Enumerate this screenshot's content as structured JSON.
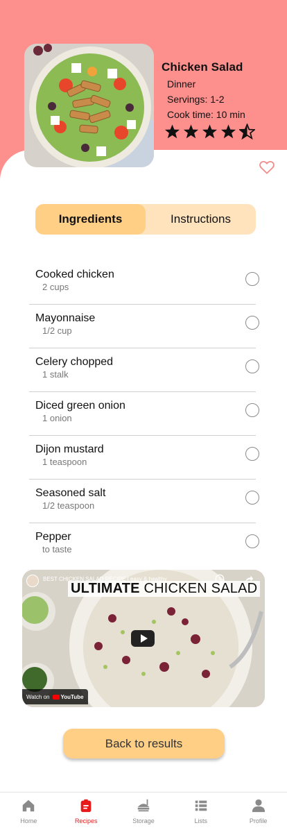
{
  "recipe": {
    "title": "Chicken Salad",
    "meal_type": "Dinner",
    "servings": "Servings: 1-2",
    "cook_time": "Cook time: 10 min",
    "rating": 4.5,
    "rating_max": 5
  },
  "tabs": [
    {
      "label": "Ingredients",
      "active": true
    },
    {
      "label": "Instructions",
      "active": false
    }
  ],
  "ingredients": [
    {
      "name": "Cooked chicken",
      "qty": "2 cups",
      "checked": false
    },
    {
      "name": "Mayonnaise",
      "qty": "1/2 cup",
      "checked": false
    },
    {
      "name": "Celery chopped",
      "qty": "1 stalk",
      "checked": false
    },
    {
      "name": "Diced green onion",
      "qty": "1 onion",
      "checked": false
    },
    {
      "name": "Dijon mustard",
      "qty": "1 teaspoon",
      "checked": false
    },
    {
      "name": "Seasoned salt",
      "qty": "1/2 teaspoon",
      "checked": false
    },
    {
      "name": "Pepper",
      "qty": "to taste",
      "checked": false
    }
  ],
  "video": {
    "caption": "BEST CHICKEN SALAD RECIPE | easy & healthy",
    "title_bold": "ULTIMATE",
    "title_rest": "CHICKEN SALAD",
    "watch_on": "Watch on",
    "platform": "YouTube"
  },
  "back_button": "Back to results",
  "nav": [
    {
      "label": "Home",
      "icon": "home-icon",
      "active": false
    },
    {
      "label": "Recipes",
      "icon": "recipes-icon",
      "active": true
    },
    {
      "label": "Storage",
      "icon": "storage-icon",
      "active": false
    },
    {
      "label": "Lists",
      "icon": "lists-icon",
      "active": false
    },
    {
      "label": "Profile",
      "icon": "profile-icon",
      "active": false
    }
  ],
  "colors": {
    "header_bg": "#fd8f8d",
    "tab_active": "#ffcf86",
    "tab_inactive": "#ffe3bd",
    "nav_active": "#e8191b",
    "heart": "#f08c8a"
  }
}
